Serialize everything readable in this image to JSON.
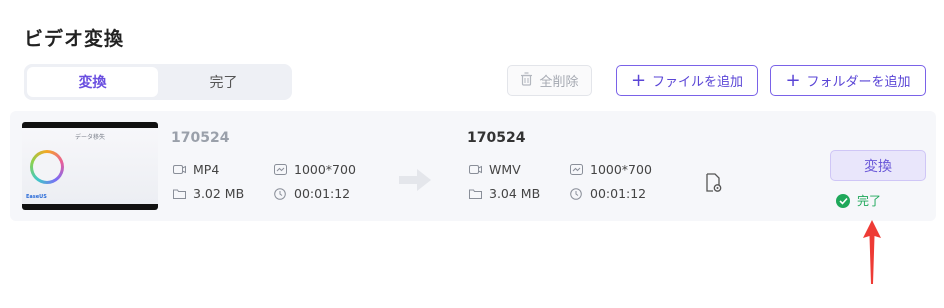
{
  "page": {
    "title": "ビデオ変換"
  },
  "tabs": [
    {
      "label": "変換",
      "active": true
    },
    {
      "label": "完了",
      "active": false
    }
  ],
  "toolbar": {
    "delete_all_label": "全削除",
    "add_file_label": "ファイルを追加",
    "add_folder_label": "フォルダーを追加"
  },
  "item": {
    "thumbnail": {
      "title": "データ移失",
      "logo_text": "EaseUS"
    },
    "source": {
      "name": "170524",
      "format": "MP4",
      "resolution": "1000*700",
      "size": "3.02 MB",
      "duration": "00:01:12"
    },
    "target": {
      "name": "170524",
      "format": "WMV",
      "resolution": "1000*700",
      "size": "3.04 MB",
      "duration": "00:01:12"
    },
    "convert_label": "変換",
    "status_label": "完了"
  },
  "colors": {
    "accent": "#6a4fe0",
    "success": "#1fa85a",
    "annotation": "#ee3b35"
  }
}
